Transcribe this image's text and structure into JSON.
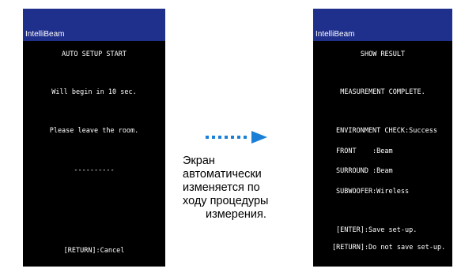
{
  "colors": {
    "screen_bg": "#000000",
    "title_bar": "#1f2f8c",
    "screen_text": "#ffffff",
    "arrow": "#1a7fd6"
  },
  "left_screen": {
    "logo": "IntelliBeam",
    "heading": "AUTO SETUP START",
    "countdown": "Will begin in 10 sec.",
    "instruction": "Please leave the room.",
    "progress": "----------",
    "cancel": "[RETURN]:Cancel"
  },
  "arrow": {
    "icon": "dotted-right-arrow-icon"
  },
  "caption": {
    "lines": [
      "Экран",
      "автоматически",
      "изменяется по",
      "ходу процедуры",
      "измерения."
    ]
  },
  "right_screen": {
    "logo": "IntelliBeam",
    "heading": "SHOW RESULT",
    "status": "MEASUREMENT COMPLETE.",
    "env_check": "ENVIRONMENT CHECK:Success",
    "front": "FRONT    :Beam",
    "surround": "SURROUND :Beam",
    "subwoofer": "SUBWOOFER:Wireless",
    "save": "[ENTER]:Save set-up.",
    "discard": "[RETURN]:Do not save set-up."
  }
}
